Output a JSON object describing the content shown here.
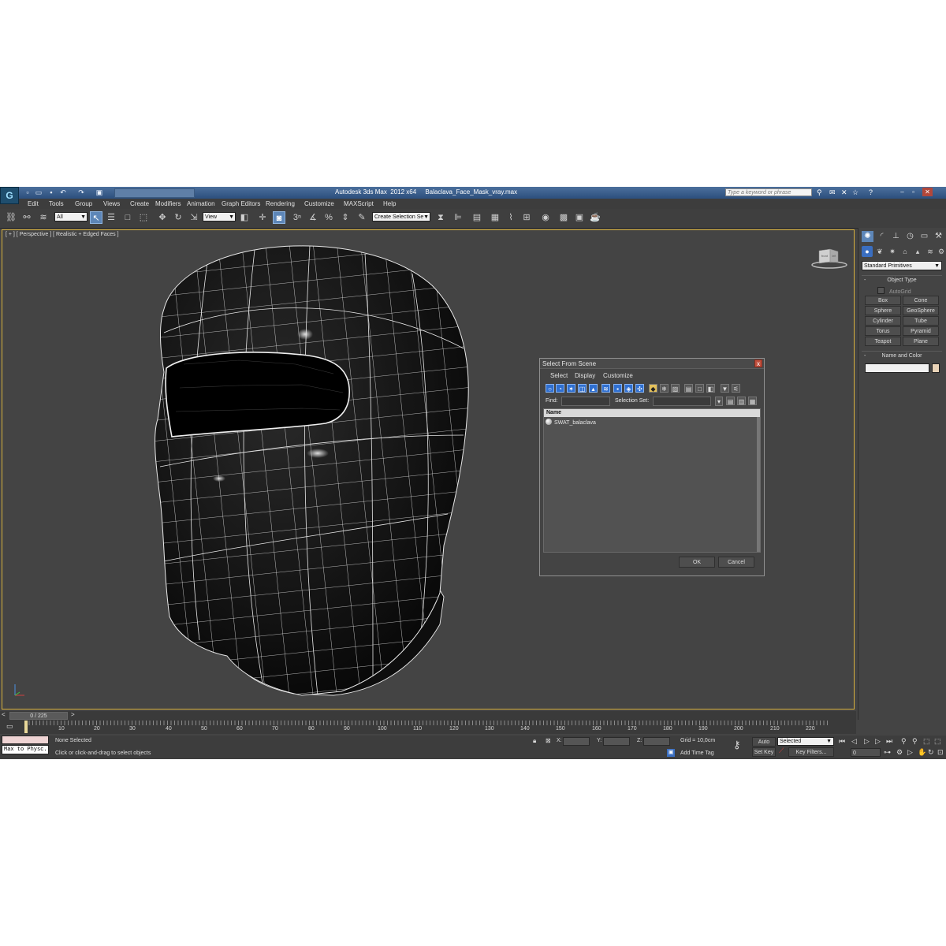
{
  "titlebar": {
    "app_logo": "G",
    "app_title": "Autodesk 3ds Max  2012 x64",
    "file_name": "Balaclava_Face_Mask_vray.max",
    "search_placeholder": "Type a keyword or phrase",
    "quick_access_icons": [
      "new-file-icon",
      "open-file-icon",
      "save-icon",
      "undo-icon",
      "redo-icon",
      "project-folder-icon"
    ]
  },
  "menu": [
    "Edit",
    "Tools",
    "Group",
    "Views",
    "Create",
    "Modifiers",
    "Animation",
    "Graph Editors",
    "Rendering",
    "Customize",
    "MAXScript",
    "Help"
  ],
  "toolbar": {
    "selection_filter": "All",
    "reference_coord": "View",
    "named_selection": "Create Selection Se",
    "snap_labels": [
      "3",
      "%"
    ]
  },
  "viewport": {
    "label": "[ + ] [ Perspective ] [ Realistic + Edged Faces ]",
    "viewcube_face": "front",
    "viewcube_side": "left"
  },
  "command_panel": {
    "category": "Standard Primitives",
    "object_type_title": "Object Type",
    "autogrid_label": "AutoGrid",
    "primitives": [
      "Box",
      "Cone",
      "Sphere",
      "GeoSphere",
      "Cylinder",
      "Tube",
      "Torus",
      "Pyramid",
      "Teapot",
      "Plane"
    ],
    "name_color_title": "Name and Color",
    "swatch_color": "#ead4b8"
  },
  "dialog": {
    "title": "Select From Scene",
    "close": "x",
    "menu": [
      "Select",
      "Display",
      "Customize"
    ],
    "find_label": "Find:",
    "selection_set_label": "Selection Set:",
    "column_name": "Name",
    "items": [
      "SWAT_balaclava"
    ],
    "ok_label": "OK",
    "cancel_label": "Cancel"
  },
  "timeline": {
    "frame_indicator": "0 / 225",
    "prev": "<",
    "next": ">",
    "ticks": [
      "10",
      "20",
      "30",
      "40",
      "50",
      "60",
      "70",
      "80",
      "90",
      "100",
      "110",
      "120",
      "130",
      "140",
      "150",
      "160",
      "170",
      "180",
      "190",
      "200",
      "210",
      "220"
    ]
  },
  "status": {
    "maxscript_output": "Max to Physc.",
    "selection_status": "None Selected",
    "prompt": "Click or click-and-drag to select objects",
    "x_label": "X:",
    "y_label": "Y:",
    "z_label": "Z:",
    "grid": "Grid = 10,0cm",
    "auto_key": "Auto Key",
    "auto_key_mode": "Selected",
    "set_key": "Set Key",
    "key_filters": "Key Filters...",
    "add_time_tag": "Add Time Tag",
    "current_frame": "0"
  }
}
